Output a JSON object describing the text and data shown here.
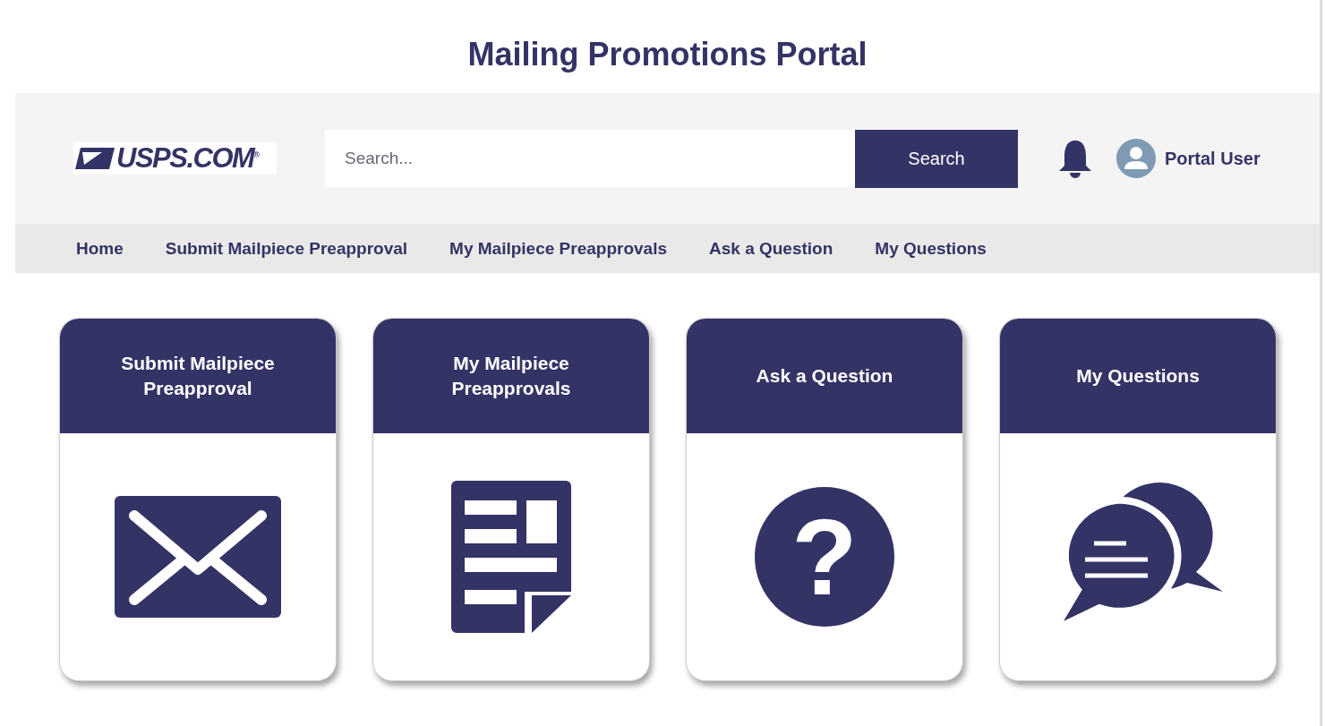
{
  "title": "Mailing Promotions Portal",
  "header": {
    "logo": "USPS.COM$^{®}$",
    "search": {
      "placeholder": "Search...",
      "button": "Search"
    },
    "user": "Portal User"
  },
  "nav": [
    "Home",
    "Submit Mailpiece Preapproval",
    "My Mailpiece Preapprovals",
    "Ask a Question",
    "My Questions"
  ],
  "cards": [
    {
      "title": "Submit Mailpiece Preapproval",
      "kind": "envelope"
    },
    {
      "title": "My Mailpiece Preapprovals",
      "kind": "document"
    },
    {
      "title": "Ask a Question",
      "kind": "question",
      "glyph": "?"
    },
    {
      "title": "My Questions",
      "kind": "chat"
    }
  ]
}
